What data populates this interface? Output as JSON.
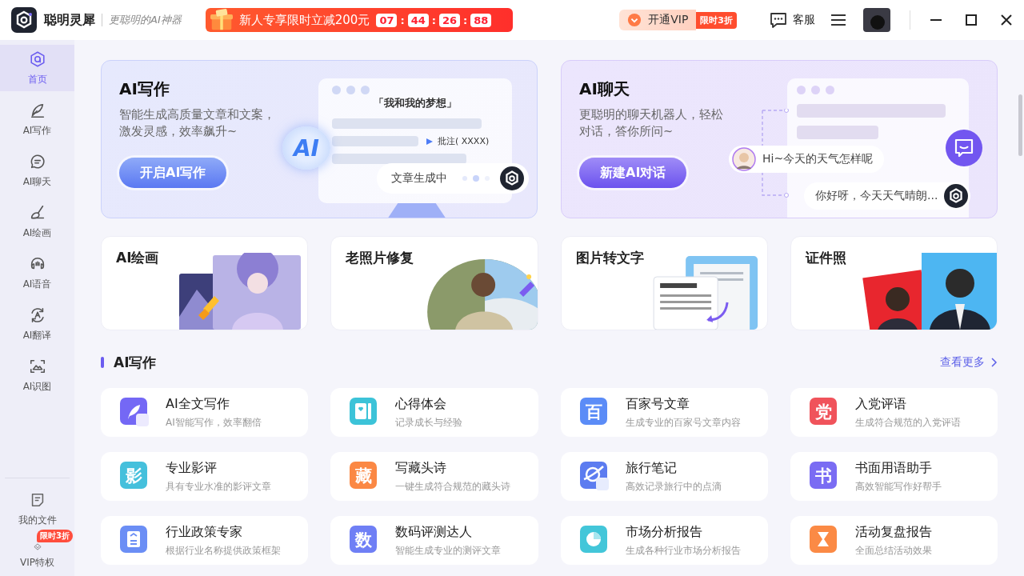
{
  "app": {
    "name": "聪明灵犀",
    "tagline": "更聪明的AI神器"
  },
  "promo": {
    "text": "新人专享限时立减200元",
    "countdown": [
      "07",
      "44",
      "26",
      "88"
    ],
    "separator": ":"
  },
  "vip": {
    "label": "开通VIP",
    "tag": "限时3折"
  },
  "service": {
    "label": "客服"
  },
  "sidebar": {
    "items": [
      {
        "label": "首页",
        "kind": "home",
        "selected": true
      },
      {
        "label": "AI写作",
        "kind": "quill",
        "selected": false
      },
      {
        "label": "AI聊天",
        "kind": "chat",
        "selected": false
      },
      {
        "label": "AI绘画",
        "kind": "brush",
        "selected": false
      },
      {
        "label": "AI语音",
        "kind": "headset",
        "selected": false
      },
      {
        "label": "AI翻译",
        "kind": "translate",
        "selected": false
      },
      {
        "label": "AI识图",
        "kind": "scan",
        "selected": false
      }
    ],
    "bottom": [
      {
        "label": "我的文件",
        "kind": "file",
        "selected": false
      },
      {
        "label": "VIP特权",
        "kind": "diamond",
        "selected": false,
        "badge": "限时3折"
      }
    ]
  },
  "heroes": [
    {
      "kind": "writing",
      "title": "AI写作",
      "description": "智能生成高质量文章和文案，激发灵感，效率飙升~",
      "button": "开启AI写作",
      "doc_title": "「我和我的梦想」",
      "note": "批注( XXXX)",
      "badge": "AI",
      "status": "文章生成中"
    },
    {
      "kind": "chat",
      "title": "AI聊天",
      "description": "更聪明的聊天机器人，轻松对话，答你所问~",
      "button": "新建AI对话",
      "question": "Hi~今天的天气怎样呢",
      "answer": "你好呀，今天天气晴朗..."
    }
  ],
  "tools": [
    {
      "title": "AI绘画"
    },
    {
      "title": "老照片修复"
    },
    {
      "title": "图片转文字"
    },
    {
      "title": "证件照"
    }
  ],
  "section": {
    "title": "AI写作",
    "more": "查看更多"
  },
  "features": [
    {
      "title": "AI全文写作",
      "description": "AI智能写作，效率翻倍",
      "kind": "quill",
      "color": "#7468f5"
    },
    {
      "title": "心得体会",
      "description": "记录成长与经验",
      "kind": "notebook",
      "color": "#3cc3d8"
    },
    {
      "title": "百家号文章",
      "description": "生成专业的百家号文章内容",
      "kind": "glyph",
      "glyph": "百",
      "color": "#5b8cf7"
    },
    {
      "title": "入党评语",
      "description": "生成符合规范的入党评语",
      "kind": "glyph",
      "glyph": "党",
      "color": "#f0535b"
    },
    {
      "title": "专业影评",
      "description": "具有专业水准的影评文章",
      "kind": "glyph",
      "glyph": "影",
      "color": "#45c0dc"
    },
    {
      "title": "写藏头诗",
      "description": "一键生成符合规范的藏头诗",
      "kind": "glyph",
      "glyph": "藏",
      "color": "#fb8844"
    },
    {
      "title": "旅行笔记",
      "description": "高效记录旅行中的点滴",
      "kind": "planet",
      "color": "#5c7cf0"
    },
    {
      "title": "书面用语助手",
      "description": "高效智能写作好帮手",
      "kind": "glyph",
      "glyph": "书",
      "color": "#7a6cf3"
    },
    {
      "title": "行业政策专家",
      "description": "根据行业名称提供政策框架",
      "kind": "document",
      "color": "#6b8ef5"
    },
    {
      "title": "数码评测达人",
      "description": "智能生成专业的测评文章",
      "kind": "glyph",
      "glyph": "数",
      "color": "#6f7ff5"
    },
    {
      "title": "市场分析报告",
      "description": "生成各种行业市场分析报告",
      "kind": "pie",
      "color": "#43c6d9"
    },
    {
      "title": "活动复盘报告",
      "description": "全面总结活动效果",
      "kind": "hourglass",
      "color": "#fb8a45"
    }
  ]
}
